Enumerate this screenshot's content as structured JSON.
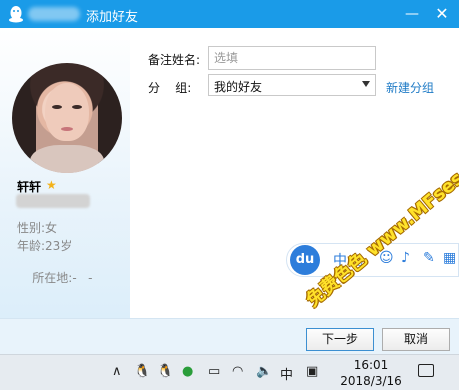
{
  "window": {
    "title": "添加好友"
  },
  "profile": {
    "nickname": "轩轩",
    "gender_label": "性别:",
    "gender": "女",
    "age_label": "年龄:",
    "age": "23岁",
    "location_label": "所在地:",
    "location": "-   -"
  },
  "form": {
    "remark_label": "备注姓名:",
    "remark_placeholder": "选填",
    "remark_value": "",
    "group_label": "分    组:",
    "group_value": "我的好友",
    "new_group_link": "新建分组"
  },
  "buttons": {
    "next": "下一步",
    "cancel": "取消"
  },
  "ime": {
    "logo": "du",
    "mode": "中"
  },
  "taskbar": {
    "ime_mode": "中",
    "time": "16:01",
    "date": "2018/3/16"
  },
  "watermark": {
    "text": "免费色色  www.MFsese.com"
  },
  "colors": {
    "titlebar": "#1a9be8",
    "link": "#1f7bc6",
    "ime_blue": "#2d7ddb"
  }
}
